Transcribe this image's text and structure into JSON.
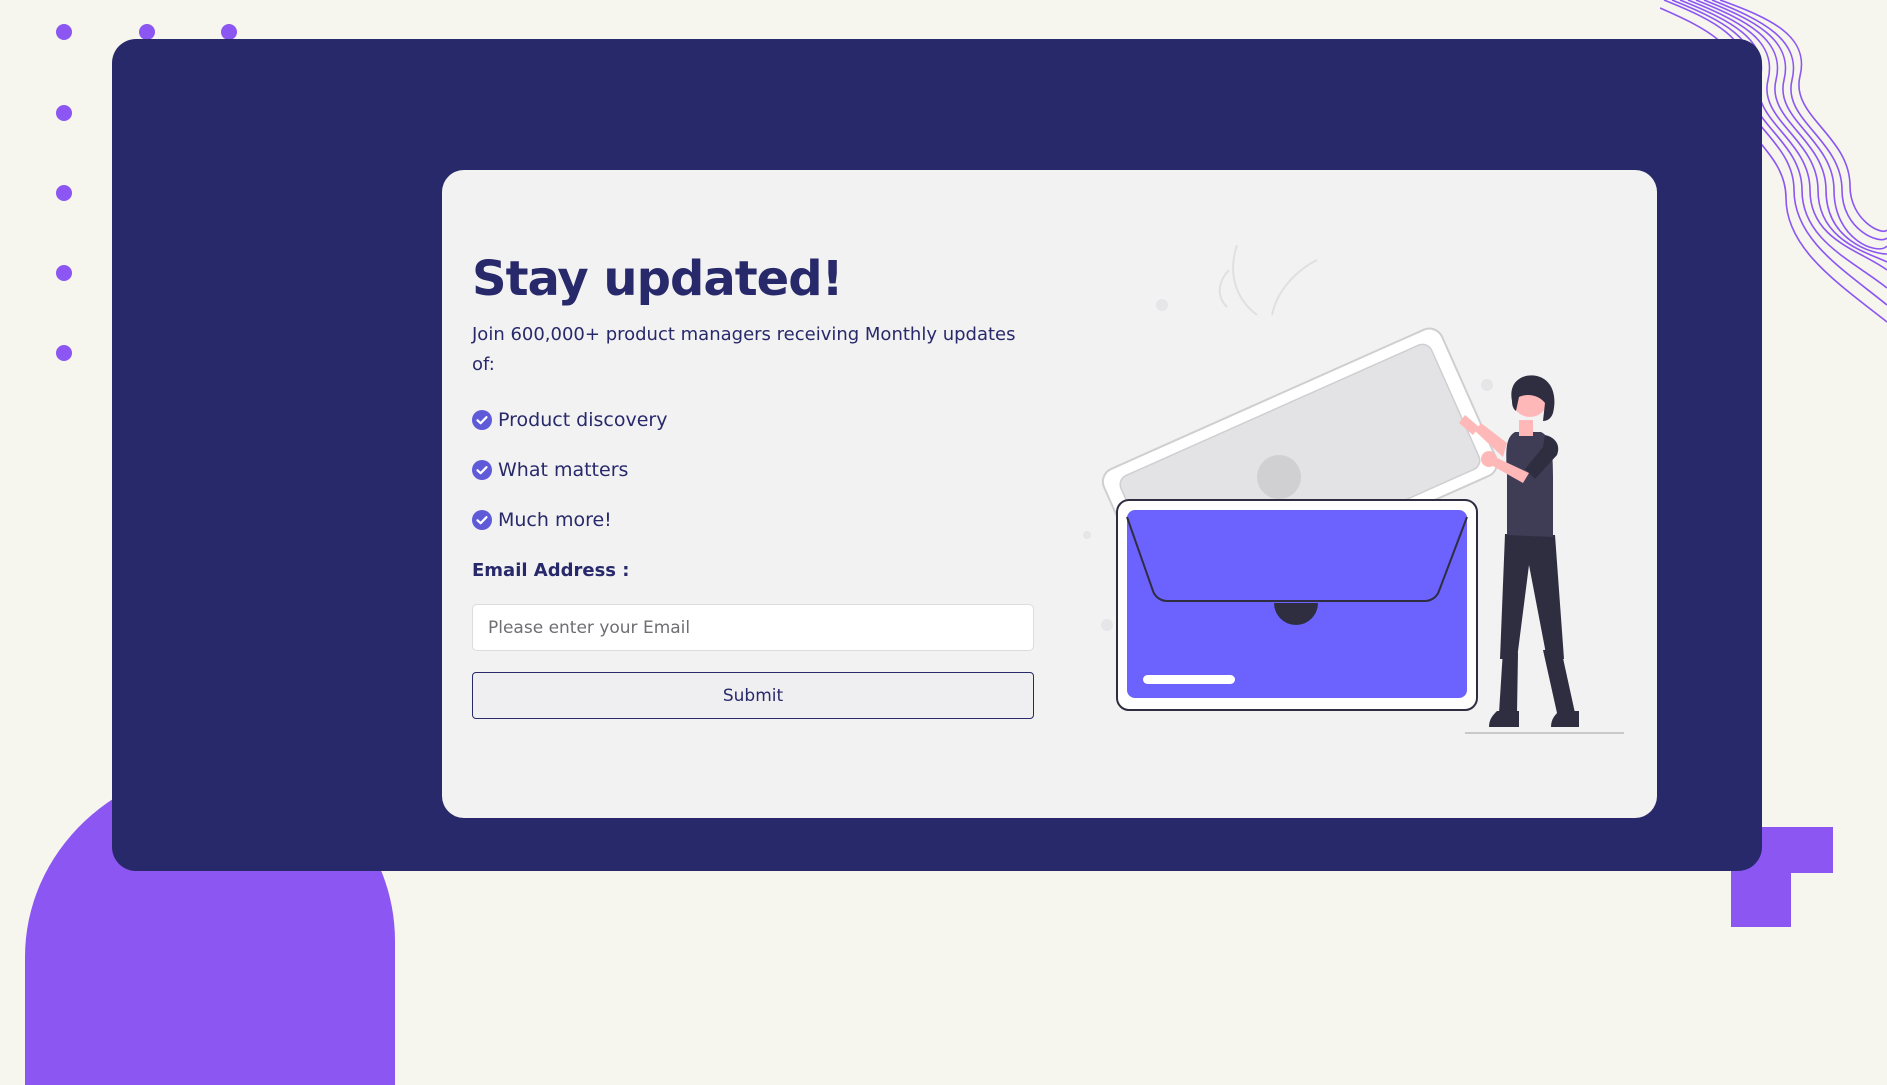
{
  "card": {
    "title": "Stay updated!",
    "intro": "Join 600,000+ product managers receiving Monthly updates of:",
    "features": [
      {
        "label": "Product discovery",
        "icon": "check-circle-icon"
      },
      {
        "label": "What matters",
        "icon": "check-circle-icon"
      },
      {
        "label": "Much more!",
        "icon": "check-circle-icon"
      }
    ],
    "email": {
      "label": "Email Address :",
      "placeholder": "Please enter your Email",
      "value": ""
    },
    "submit_label": "Submit"
  },
  "illustration": {
    "icon": "envelope-with-person-illustration"
  },
  "colors": {
    "page_background": "#f6f5ee",
    "panel_navy": "#28296a",
    "card_background": "#f2f2f3",
    "accent_purple": "#8b56f1",
    "envelope_blue": "#6c63ff"
  }
}
